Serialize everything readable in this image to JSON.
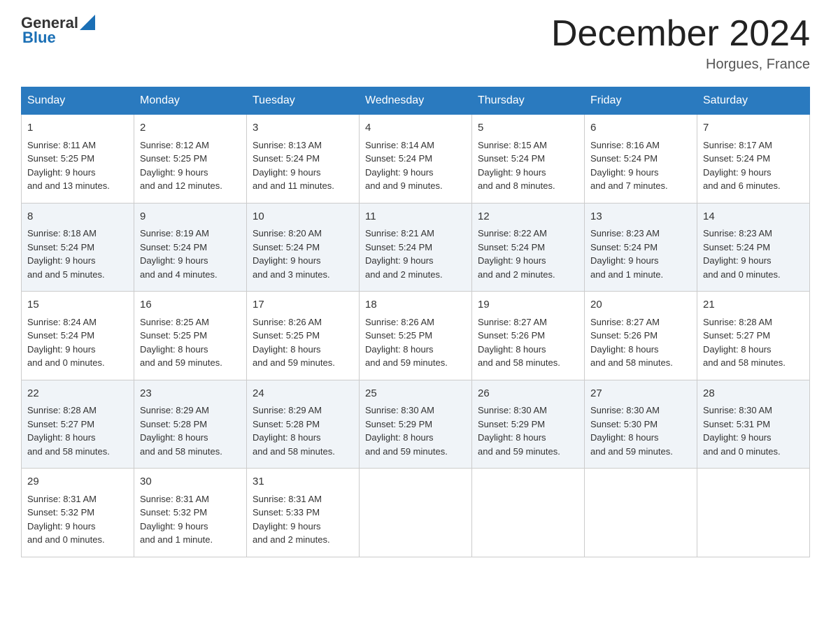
{
  "header": {
    "logo_general": "General",
    "logo_blue": "Blue",
    "month_title": "December 2024",
    "location": "Horgues, France"
  },
  "days_of_week": [
    "Sunday",
    "Monday",
    "Tuesday",
    "Wednesday",
    "Thursday",
    "Friday",
    "Saturday"
  ],
  "weeks": [
    [
      {
        "day": "1",
        "sunrise": "8:11 AM",
        "sunset": "5:25 PM",
        "daylight": "9 hours and 13 minutes."
      },
      {
        "day": "2",
        "sunrise": "8:12 AM",
        "sunset": "5:25 PM",
        "daylight": "9 hours and 12 minutes."
      },
      {
        "day": "3",
        "sunrise": "8:13 AM",
        "sunset": "5:24 PM",
        "daylight": "9 hours and 11 minutes."
      },
      {
        "day": "4",
        "sunrise": "8:14 AM",
        "sunset": "5:24 PM",
        "daylight": "9 hours and 9 minutes."
      },
      {
        "day": "5",
        "sunrise": "8:15 AM",
        "sunset": "5:24 PM",
        "daylight": "9 hours and 8 minutes."
      },
      {
        "day": "6",
        "sunrise": "8:16 AM",
        "sunset": "5:24 PM",
        "daylight": "9 hours and 7 minutes."
      },
      {
        "day": "7",
        "sunrise": "8:17 AM",
        "sunset": "5:24 PM",
        "daylight": "9 hours and 6 minutes."
      }
    ],
    [
      {
        "day": "8",
        "sunrise": "8:18 AM",
        "sunset": "5:24 PM",
        "daylight": "9 hours and 5 minutes."
      },
      {
        "day": "9",
        "sunrise": "8:19 AM",
        "sunset": "5:24 PM",
        "daylight": "9 hours and 4 minutes."
      },
      {
        "day": "10",
        "sunrise": "8:20 AM",
        "sunset": "5:24 PM",
        "daylight": "9 hours and 3 minutes."
      },
      {
        "day": "11",
        "sunrise": "8:21 AM",
        "sunset": "5:24 PM",
        "daylight": "9 hours and 2 minutes."
      },
      {
        "day": "12",
        "sunrise": "8:22 AM",
        "sunset": "5:24 PM",
        "daylight": "9 hours and 2 minutes."
      },
      {
        "day": "13",
        "sunrise": "8:23 AM",
        "sunset": "5:24 PM",
        "daylight": "9 hours and 1 minute."
      },
      {
        "day": "14",
        "sunrise": "8:23 AM",
        "sunset": "5:24 PM",
        "daylight": "9 hours and 0 minutes."
      }
    ],
    [
      {
        "day": "15",
        "sunrise": "8:24 AM",
        "sunset": "5:24 PM",
        "daylight": "9 hours and 0 minutes."
      },
      {
        "day": "16",
        "sunrise": "8:25 AM",
        "sunset": "5:25 PM",
        "daylight": "8 hours and 59 minutes."
      },
      {
        "day": "17",
        "sunrise": "8:26 AM",
        "sunset": "5:25 PM",
        "daylight": "8 hours and 59 minutes."
      },
      {
        "day": "18",
        "sunrise": "8:26 AM",
        "sunset": "5:25 PM",
        "daylight": "8 hours and 59 minutes."
      },
      {
        "day": "19",
        "sunrise": "8:27 AM",
        "sunset": "5:26 PM",
        "daylight": "8 hours and 58 minutes."
      },
      {
        "day": "20",
        "sunrise": "8:27 AM",
        "sunset": "5:26 PM",
        "daylight": "8 hours and 58 minutes."
      },
      {
        "day": "21",
        "sunrise": "8:28 AM",
        "sunset": "5:27 PM",
        "daylight": "8 hours and 58 minutes."
      }
    ],
    [
      {
        "day": "22",
        "sunrise": "8:28 AM",
        "sunset": "5:27 PM",
        "daylight": "8 hours and 58 minutes."
      },
      {
        "day": "23",
        "sunrise": "8:29 AM",
        "sunset": "5:28 PM",
        "daylight": "8 hours and 58 minutes."
      },
      {
        "day": "24",
        "sunrise": "8:29 AM",
        "sunset": "5:28 PM",
        "daylight": "8 hours and 58 minutes."
      },
      {
        "day": "25",
        "sunrise": "8:30 AM",
        "sunset": "5:29 PM",
        "daylight": "8 hours and 59 minutes."
      },
      {
        "day": "26",
        "sunrise": "8:30 AM",
        "sunset": "5:29 PM",
        "daylight": "8 hours and 59 minutes."
      },
      {
        "day": "27",
        "sunrise": "8:30 AM",
        "sunset": "5:30 PM",
        "daylight": "8 hours and 59 minutes."
      },
      {
        "day": "28",
        "sunrise": "8:30 AM",
        "sunset": "5:31 PM",
        "daylight": "9 hours and 0 minutes."
      }
    ],
    [
      {
        "day": "29",
        "sunrise": "8:31 AM",
        "sunset": "5:32 PM",
        "daylight": "9 hours and 0 minutes."
      },
      {
        "day": "30",
        "sunrise": "8:31 AM",
        "sunset": "5:32 PM",
        "daylight": "9 hours and 1 minute."
      },
      {
        "day": "31",
        "sunrise": "8:31 AM",
        "sunset": "5:33 PM",
        "daylight": "9 hours and 2 minutes."
      },
      null,
      null,
      null,
      null
    ]
  ],
  "labels": {
    "sunrise": "Sunrise:",
    "sunset": "Sunset:",
    "daylight": "Daylight:"
  }
}
